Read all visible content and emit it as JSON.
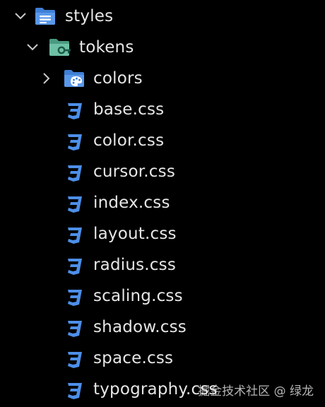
{
  "colors": {
    "background": "#000000",
    "text": "#e6e6e6",
    "chevron": "#c8c8c8",
    "css_icon": "#4d8fe8",
    "styles_folder": "#3f7fd6",
    "tokens_folder": "#4a9a82",
    "colors_folder": "#3f7fd6"
  },
  "tree": {
    "styles": {
      "name": "styles",
      "expanded": true,
      "icon": "styles-folder-icon"
    },
    "tokens": {
      "name": "tokens",
      "expanded": true,
      "icon": "tokens-folder-icon"
    },
    "colors": {
      "name": "colors",
      "expanded": false,
      "icon": "palette-folder-icon"
    },
    "files": [
      {
        "name": "base.css",
        "icon": "css-file-icon"
      },
      {
        "name": "color.css",
        "icon": "css-file-icon"
      },
      {
        "name": "cursor.css",
        "icon": "css-file-icon"
      },
      {
        "name": "index.css",
        "icon": "css-file-icon"
      },
      {
        "name": "layout.css",
        "icon": "css-file-icon"
      },
      {
        "name": "radius.css",
        "icon": "css-file-icon"
      },
      {
        "name": "scaling.css",
        "icon": "css-file-icon"
      },
      {
        "name": "shadow.css",
        "icon": "css-file-icon"
      },
      {
        "name": "space.css",
        "icon": "css-file-icon"
      },
      {
        "name": "typography.css",
        "icon": "css-file-icon"
      }
    ]
  },
  "watermark": "掘金技术社区 @ 绿龙"
}
